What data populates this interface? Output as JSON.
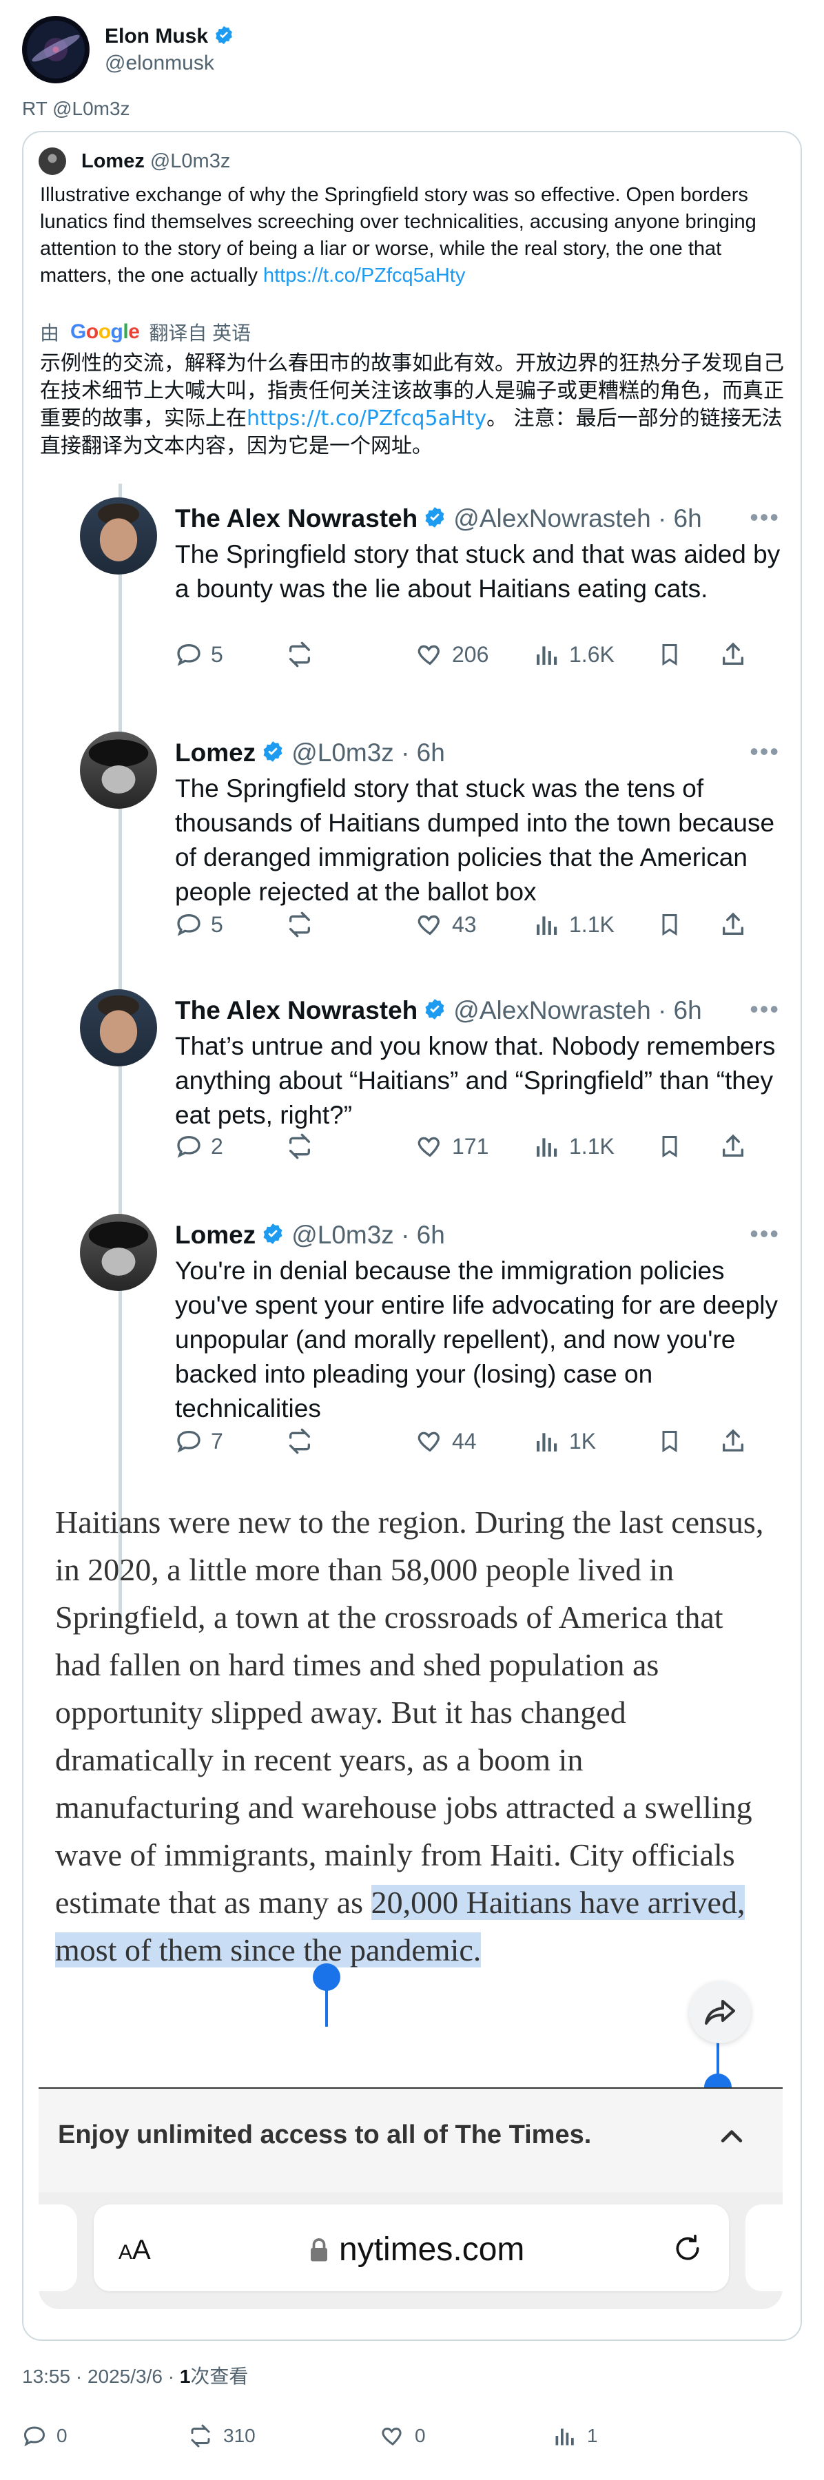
{
  "outer": {
    "name": "Elon Musk",
    "handle": "@elonmusk",
    "rt_line": "RT @L0m3z"
  },
  "quote": {
    "name": "Lomez",
    "handle": "@L0m3z",
    "text": "Illustrative exchange of why the Springfield story was so effective. Open borders lunatics find themselves screeching over technicalities, accusing anyone bringing attention to the story of being a liar or worse, while the real story, the one that matters, the one actually ",
    "link": "https://t.co/PZfcq5aHty",
    "translate_prefix": "由",
    "google": [
      "G",
      "o",
      "o",
      "g",
      "l",
      "e"
    ],
    "translate_suffix": "翻译自 英语",
    "zh_text_a": "示例性的交流，解释为什么春田市的故事如此有效。开放边界的狂热分子发现自己在技术细节上大喊大叫，指责任何关注该故事的人是骗子或更糟糕的角色，而真正重要的故事，实际上在",
    "zh_link": "https://t.co/PZfcq5aHty",
    "zh_text_b": "。 注意：最后一部分的链接无法直接翻译为文本内容，因为它是一个网址。"
  },
  "thread": [
    {
      "name": "The Alex Nowrasteh",
      "handle": "@AlexNowrasteh · 6h",
      "text": "The Springfield story that stuck and that was aided by a bounty was the lie about Haitians eating cats.",
      "replies": "5",
      "likes": "206",
      "views": "1.6K"
    },
    {
      "name": "Lomez",
      "handle": "@L0m3z · 6h",
      "text": "The Springfield story that stuck was the tens of thousands of Haitians dumped into the town because of deranged immigration policies that the American people rejected at the ballot box",
      "replies": "5",
      "likes": "43",
      "views": "1.1K"
    },
    {
      "name": "The Alex Nowrasteh",
      "handle": "@AlexNowrasteh · 6h",
      "text": "That’s untrue and you know that. Nobody remembers anything about “Haitians” and “Springfield” than “they eat pets, right?”",
      "replies": "2",
      "likes": "171",
      "views": "1.1K"
    },
    {
      "name": "Lomez",
      "handle": "@L0m3z · 6h",
      "text": "You're in denial because the immigration policies you've spent your entire life advocating for are deeply unpopular (and morally repellent), and now you're backed into pleading your (losing) case on technicalities",
      "replies": "7",
      "likes": "44",
      "views": "1K"
    }
  ],
  "article": {
    "text_a": "Haitians were new to the region. During the last census, in 2020, a little more than 58,000 people lived in Springfield, a town at the crossroads of America that had fallen on hard times and shed population as opportunity slipped away. But it has changed dramatically in recent years, as a boom in manufacturing and warehouse jobs attracted a swelling wave of immigrants, mainly from Haiti. City officials estimate that as many as ",
    "text_highlight": "20,000 Haitians have arrived, most of them since the pandemic.",
    "banner": "Enjoy unlimited access to all of The Times.",
    "aa_small": "A",
    "aa_big": "A",
    "url": "nytimes.com"
  },
  "footer": {
    "time": "13:55 · 2025/3/6 · ",
    "views_count": "1",
    "views_label": "次查看",
    "replies": "0",
    "retweets": "310",
    "likes": "0",
    "views": "1"
  },
  "colors": {
    "link": "#1d9bf0",
    "verified": "#1d9bf0",
    "selection": "#c9def5",
    "selection_handle": "#1a73e8"
  }
}
